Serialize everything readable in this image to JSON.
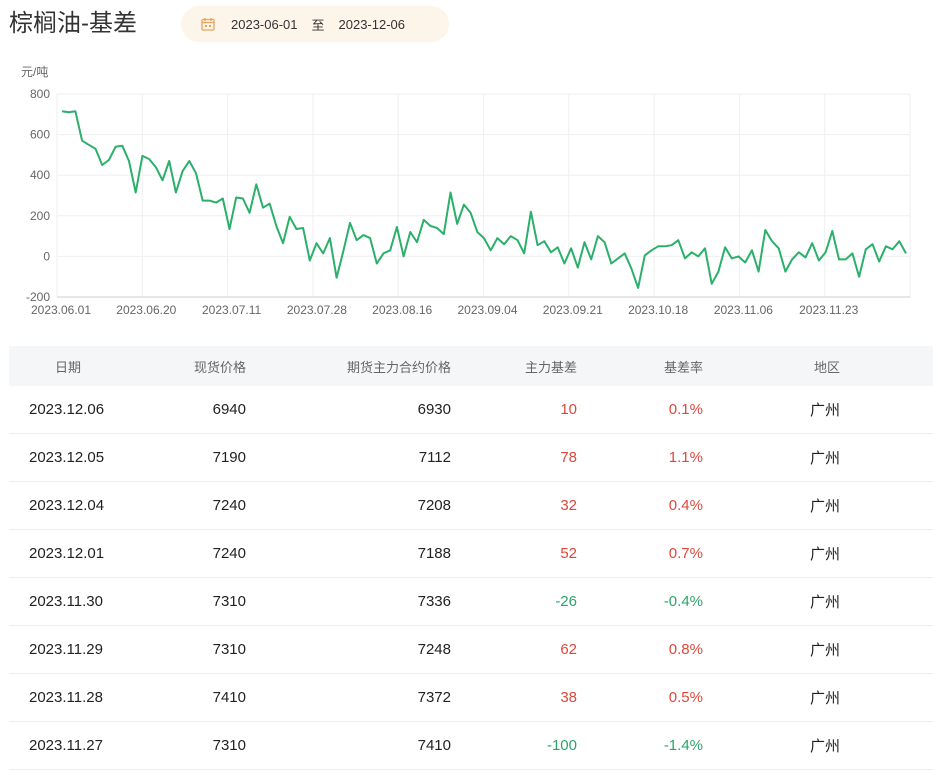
{
  "header": {
    "title": "棕榈油-基差",
    "date_start": "2023-06-01",
    "date_sep": "至",
    "date_end": "2023-12-06",
    "icon": "calendar-icon",
    "accent_color": "#e8a35b"
  },
  "chart_data": {
    "type": "line",
    "ylabel": "元/吨",
    "ylim": [
      -200,
      800
    ],
    "yticks": [
      800,
      600,
      400,
      200,
      0,
      -200
    ],
    "xtick_labels": [
      "2023.06.01",
      "2023.06.20",
      "2023.07.11",
      "2023.07.28",
      "2023.08.16",
      "2023.09.04",
      "2023.09.21",
      "2023.10.18",
      "2023.11.06",
      "2023.11.23"
    ],
    "grid": true,
    "line_color": "#2ab06a",
    "series": [
      {
        "values": [
          715,
          710,
          715,
          570,
          550,
          530,
          450,
          475,
          540,
          545,
          470,
          315,
          495,
          480,
          440,
          375,
          470,
          315,
          420,
          470,
          410,
          275,
          275,
          265,
          285,
          135,
          290,
          285,
          215,
          355,
          240,
          260,
          150,
          65,
          195,
          135,
          140,
          -20,
          65,
          15,
          90,
          -105,
          25,
          165,
          80,
          105,
          90,
          -35,
          15,
          30,
          145,
          0,
          120,
          70,
          180,
          150,
          140,
          110,
          315,
          160,
          255,
          215,
          120,
          90,
          30,
          90,
          60,
          100,
          80,
          15,
          220,
          55,
          75,
          20,
          45,
          -35,
          40,
          -55,
          70,
          -15,
          100,
          70,
          -35,
          -10,
          15,
          -60,
          -155,
          5,
          30,
          50,
          50,
          55,
          80,
          -10,
          20,
          0,
          40,
          -135,
          -75,
          45,
          -10,
          0,
          -30,
          30,
          -75,
          130,
          75,
          40,
          -75,
          -15,
          20,
          -5,
          65,
          -20,
          20,
          125,
          -15,
          -15,
          15,
          -100,
          35,
          60,
          -25,
          50,
          35,
          75,
          15
        ]
      }
    ]
  },
  "table": {
    "headers": [
      "日期",
      "现货价格",
      "期货主力合约价格",
      "主力基差",
      "基差率",
      "地区"
    ],
    "rows": [
      {
        "date": "2023.12.06",
        "spot": "6940",
        "futures": "6930",
        "basis": "10",
        "rate": "0.1%",
        "region": "广州"
      },
      {
        "date": "2023.12.05",
        "spot": "7190",
        "futures": "7112",
        "basis": "78",
        "rate": "1.1%",
        "region": "广州"
      },
      {
        "date": "2023.12.04",
        "spot": "7240",
        "futures": "7208",
        "basis": "32",
        "rate": "0.4%",
        "region": "广州"
      },
      {
        "date": "2023.12.01",
        "spot": "7240",
        "futures": "7188",
        "basis": "52",
        "rate": "0.7%",
        "region": "广州"
      },
      {
        "date": "2023.11.30",
        "spot": "7310",
        "futures": "7336",
        "basis": "-26",
        "rate": "-0.4%",
        "region": "广州"
      },
      {
        "date": "2023.11.29",
        "spot": "7310",
        "futures": "7248",
        "basis": "62",
        "rate": "0.8%",
        "region": "广州"
      },
      {
        "date": "2023.11.28",
        "spot": "7410",
        "futures": "7372",
        "basis": "38",
        "rate": "0.5%",
        "region": "广州"
      },
      {
        "date": "2023.11.27",
        "spot": "7310",
        "futures": "7410",
        "basis": "-100",
        "rate": "-1.4%",
        "region": "广州"
      }
    ],
    "positive_color": "#e0473c",
    "negative_color": "#2aa56b"
  }
}
